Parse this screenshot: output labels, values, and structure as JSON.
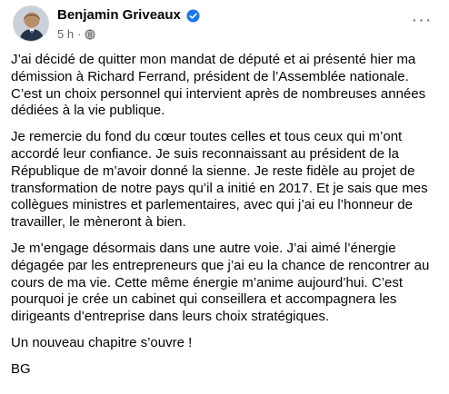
{
  "post": {
    "author": "Benjamin Griveaux",
    "timestamp": "5 h",
    "separator": "·",
    "verified": true,
    "menu": "···",
    "paragraphs": [
      "J’ai décidé de quitter mon mandat de député et ai présenté hier ma démission à Richard Ferrand, président de l’Assemblée nationale. C’est un choix personnel qui intervient après de nombreuses années dédiées à la vie publique.",
      "Je remercie du fond du cœur toutes celles et tous ceux qui m’ont accordé leur confiance. Je suis reconnaissant au président de la République de m’avoir donné la sienne. Je reste fidèle au projet de transformation de notre pays qu’il a initié en 2017. Et je sais que mes collègues ministres et parlementaires, avec qui j’ai eu l’honneur de travailler, le mèneront à bien.",
      "Je m’engage désormais dans une autre voie. J’ai aimé l’énergie dégagée par les entrepreneurs que j’ai eu la chance de rencontrer au cours de ma vie. Cette même énergie m’anime aujourd’hui. C’est pourquoi je crée un cabinet qui conseillera et accompagnera les dirigeants d’entreprise dans leurs choix stratégiques.",
      "Un nouveau chapitre s’ouvre !",
      "BG"
    ]
  },
  "icons": {
    "verified": "verified-badge-icon",
    "privacy": "globe-icon",
    "more": "more-options-icon"
  },
  "colors": {
    "text": "#050505",
    "secondary": "#65676b",
    "verified": "#1877f2"
  }
}
